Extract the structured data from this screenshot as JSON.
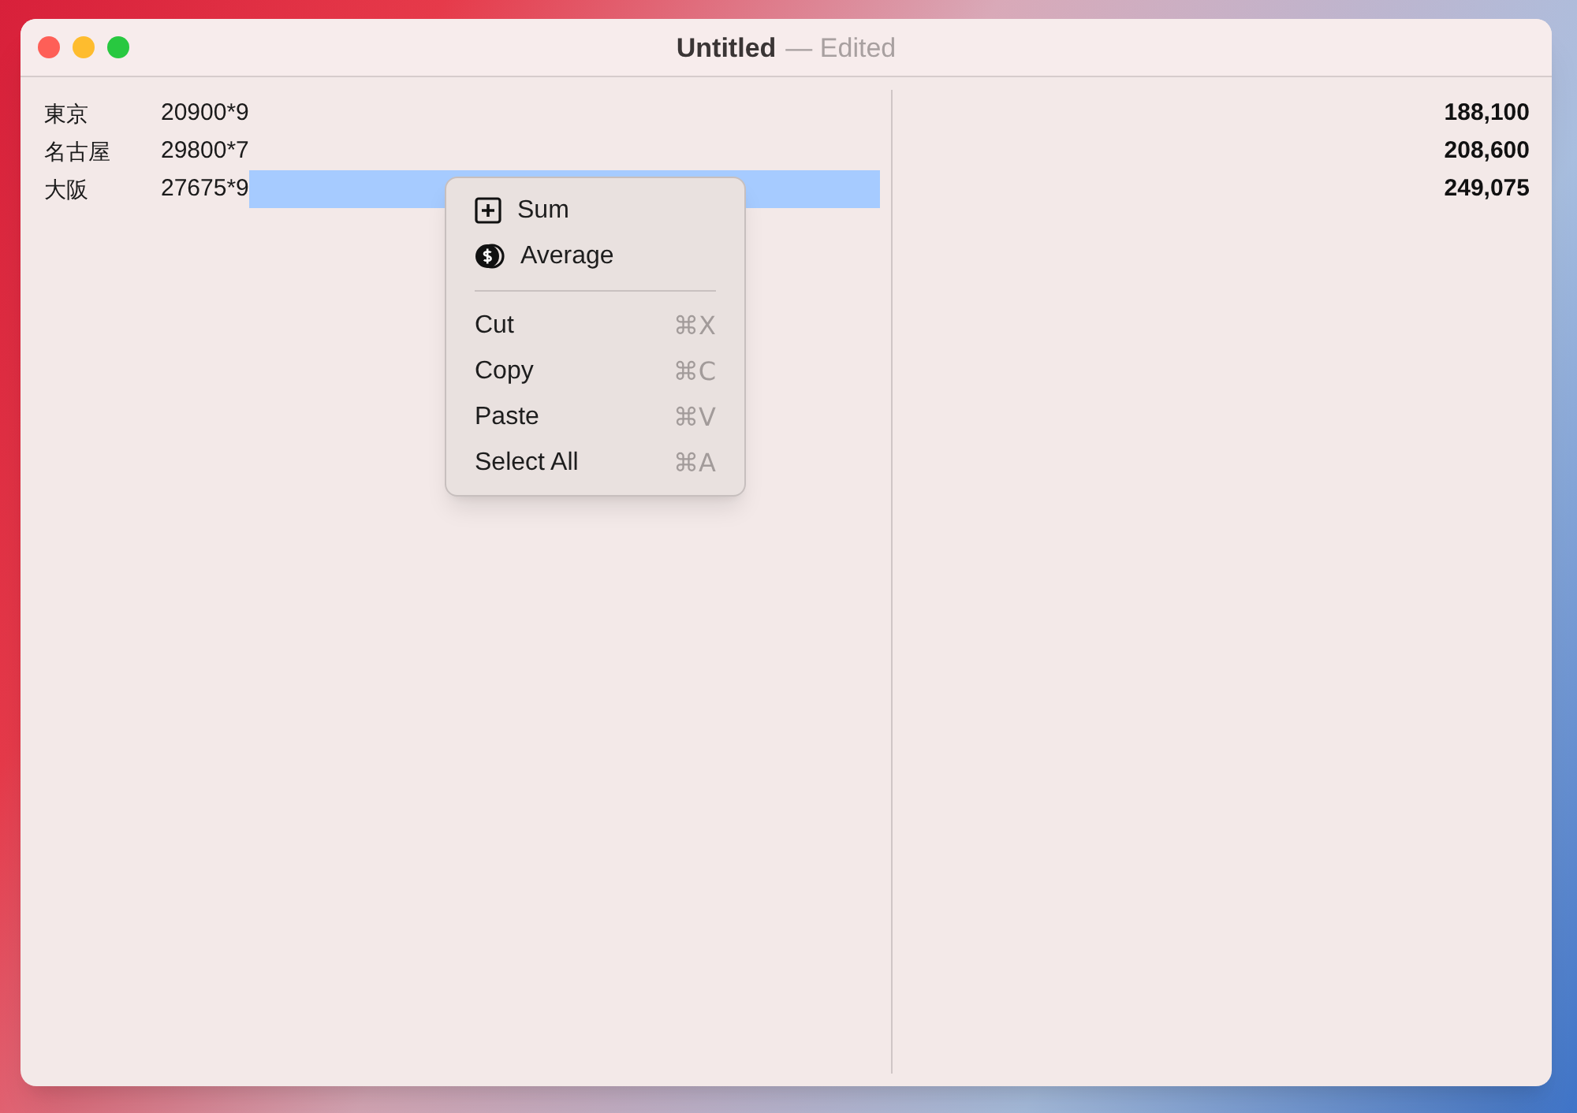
{
  "window": {
    "title": "Untitled",
    "title_suffix": "— Edited"
  },
  "lines": [
    {
      "label": "東京",
      "expression": "20900*9",
      "selected": false
    },
    {
      "label": "名古屋",
      "expression": "29800*7",
      "selected": false
    },
    {
      "label": "大阪",
      "expression": "27675*9",
      "selected": true
    }
  ],
  "results": [
    "188,100",
    "208,600",
    "249,075"
  ],
  "context_menu": {
    "items": [
      {
        "kind": "action",
        "label": "Sum"
      },
      {
        "kind": "action",
        "label": "Average"
      },
      {
        "kind": "separator"
      },
      {
        "kind": "command",
        "label": "Cut",
        "shortcut": "⌘X"
      },
      {
        "kind": "command",
        "label": "Copy",
        "shortcut": "⌘C"
      },
      {
        "kind": "command",
        "label": "Paste",
        "shortcut": "⌘V"
      },
      {
        "kind": "command",
        "label": "Select All",
        "shortcut": "⌘A"
      }
    ]
  }
}
